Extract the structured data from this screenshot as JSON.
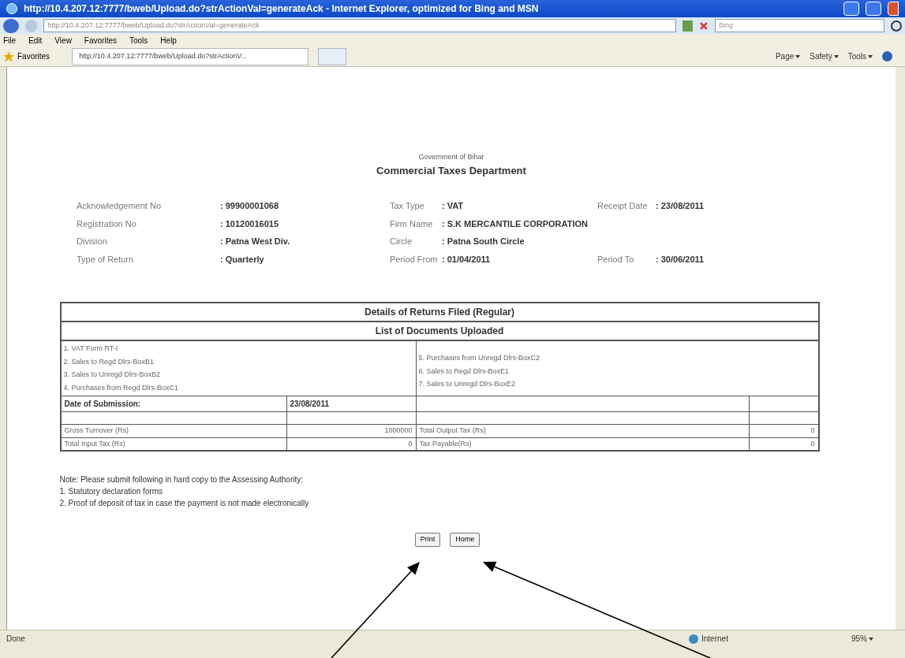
{
  "window": {
    "title": "http://10.4.207.12:7777/bweb/Upload.do?strActionVal=generateAck - Internet Explorer, optimized for Bing and MSN"
  },
  "address_bar": {
    "url": "http://10.4.207.12:7777/bweb/Upload.do?strActionVal=generateAck",
    "search_placeholder": "Bing"
  },
  "menu": [
    "File",
    "Edit",
    "View",
    "Favorites",
    "Tools",
    "Help"
  ],
  "favorites_bar": {
    "label": "Favorites",
    "tab": "http://10.4.207.12:7777/bweb/Upload.do?strActionV...",
    "commands": [
      "Page",
      "Safety",
      "Tools"
    ]
  },
  "header": {
    "subtitle": "Government of Bihar",
    "title": "Commercial Taxes Department"
  },
  "info_rows": [
    [
      {
        "label": "Acknowledgement No",
        "value": ": 99900001068"
      },
      {
        "label": "Tax Type",
        "value": ": VAT"
      },
      {
        "label": "Receipt Date",
        "value": ": 23/08/2011"
      }
    ],
    [
      {
        "label": "Registration No",
        "value": ": 10120016015"
      },
      {
        "label": "Firm Name",
        "value": ": S.K MERCANTILE CORPORATION"
      }
    ],
    [
      {
        "label": "Division",
        "value": ": Patna West Div."
      },
      {
        "label": "Circle",
        "value": ": Patna South Circle"
      }
    ],
    [
      {
        "label": "Type of Return",
        "value": ": Quarterly"
      },
      {
        "label": "Period From",
        "value": ": 01/04/2011"
      },
      {
        "label": "Period To",
        "value": ": 30/06/2011"
      }
    ]
  ],
  "table": {
    "title": "Details of Returns Filed (Regular)",
    "subtitle": "List of Documents Uploaded",
    "documents_left": [
      "1. VAT Form RT-I",
      "2. Sales to Regd Dlrs-BoxB1",
      "3. Sales to Unregd Dlrs-BoxB2",
      "4. Purchases from Regd Dlrs-BoxC1"
    ],
    "documents_right": [
      "5. Purchases from Unregd Dlrs-BoxC2",
      "6. Sales to Regd Dlrs-BoxE1",
      "7. Sales to Unregd Dlrs-BoxE2"
    ],
    "submission": {
      "label": "Date of Submission:",
      "value": "23/08/2011"
    },
    "amounts": [
      [
        "Gross Turnover (Rs)",
        "1000000",
        "Total Output Tax (Rs)",
        "0"
      ],
      [
        "Total Input Tax (Rs)",
        "0",
        "Tax Payable(Rs)",
        "0"
      ]
    ]
  },
  "note": {
    "title": "Note: Please submit following in hard copy to the Assessing Authority:",
    "items": [
      "1. Statutory declaration forms",
      "2. Proof of deposit of tax in case the payment is not made electronically"
    ]
  },
  "buttons": [
    "Print",
    "Home"
  ],
  "status_bar": {
    "text": "Done",
    "zone": "Internet",
    "zoom": "95%"
  }
}
